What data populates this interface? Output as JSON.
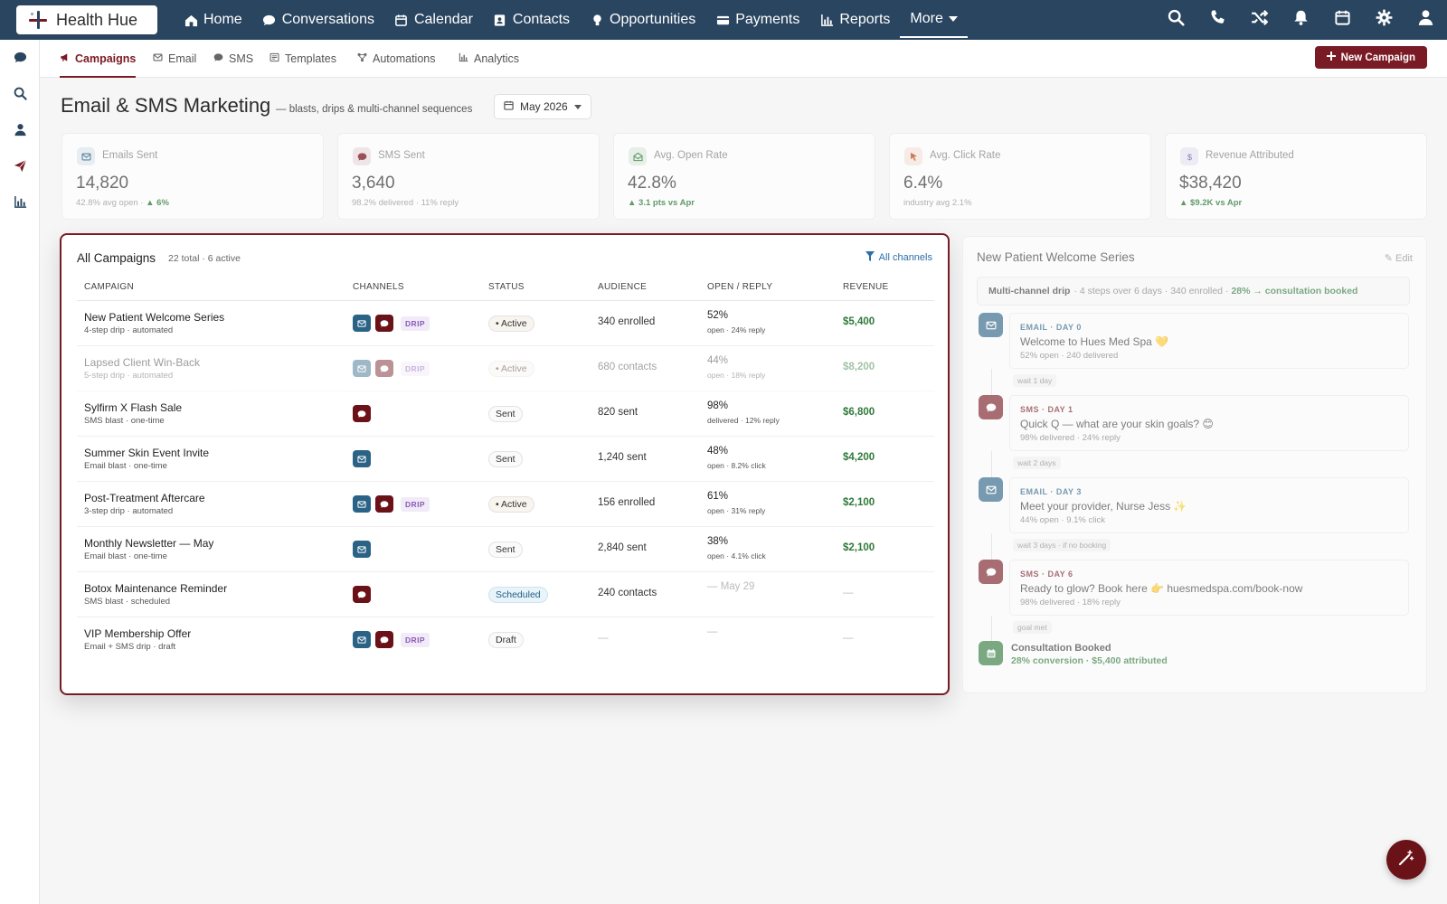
{
  "brand": {
    "name": "Health Hue"
  },
  "nav": {
    "items": [
      {
        "label": "Home",
        "icon": "home-icon"
      },
      {
        "label": "Conversations",
        "icon": "chat-icon"
      },
      {
        "label": "Calendar",
        "icon": "calendar-icon"
      },
      {
        "label": "Contacts",
        "icon": "contact-card-icon"
      },
      {
        "label": "Opportunities",
        "icon": "lightbulb-icon"
      },
      {
        "label": "Payments",
        "icon": "card-icon"
      },
      {
        "label": "Reports",
        "icon": "bar-chart-icon"
      }
    ],
    "more_label": "More",
    "right_icons": [
      "search-icon",
      "phone-icon",
      "shuffle-icon",
      "bell-icon",
      "calendar-icon",
      "gear-icon",
      "user-icon"
    ]
  },
  "rail": {
    "icons": [
      "chat-icon",
      "search-icon",
      "user-icon",
      "send-icon",
      "bar-chart-icon"
    ]
  },
  "subtabs": [
    {
      "label": "Campaigns",
      "icon": "megaphone-icon",
      "active": true
    },
    {
      "label": "Email",
      "icon": "envelope-icon"
    },
    {
      "label": "SMS",
      "icon": "chat-icon"
    },
    {
      "label": "Templates",
      "icon": "template-icon"
    },
    {
      "label": "Automations",
      "icon": "flow-icon"
    },
    {
      "label": "Analytics",
      "icon": "bar-chart-icon"
    }
  ],
  "new_campaign_label": "New Campaign",
  "header": {
    "title": "Email & SMS Marketing",
    "subtitle": "— blasts, drips & multi-channel sequences",
    "month": "May 2026"
  },
  "stats": [
    {
      "label": "Emails Sent",
      "value": "14,820",
      "note": "42.8% avg open ·",
      "delta": "▲ 6%",
      "icon": "envelope-icon",
      "color": "#2b6386"
    },
    {
      "label": "SMS Sent",
      "value": "3,640",
      "note": "98.2% delivered · 11% reply",
      "delta": "",
      "icon": "chat-icon",
      "color": "#7a1a24"
    },
    {
      "label": "Avg. Open Rate",
      "value": "42.8%",
      "note": "",
      "delta": "▲ 3.1 pts vs Apr",
      "icon": "envelope-open-icon",
      "color": "#2f7a3a"
    },
    {
      "label": "Avg. Click Rate",
      "value": "6.4%",
      "note": "industry avg 2.1%",
      "delta": "",
      "icon": "pointer-icon",
      "color": "#c2521d"
    },
    {
      "label": "Revenue Attributed",
      "value": "$38,420",
      "note": "",
      "delta": "▲ $9.2K vs Apr",
      "icon": "dollar-icon",
      "color": "#6b4fa8"
    }
  ],
  "campaigns": {
    "title": "All Campaigns",
    "count": "22 total · 6 active",
    "filter_label": "All channels",
    "columns": [
      "CAMPAIGN",
      "CHANNELS",
      "STATUS",
      "AUDIENCE",
      "OPEN / REPLY",
      "REVENUE"
    ],
    "rows": [
      {
        "name": "New Patient Welcome Series",
        "meta": "4-step drip · automated",
        "channels": [
          "email",
          "sms"
        ],
        "drip": "DRIP",
        "status": "• Active",
        "status_type": "active",
        "audience": "340 enrolled",
        "rate": "52%",
        "rate_sub": "open · 24% reply",
        "revenue": "$5,400",
        "faded": false
      },
      {
        "name": "Lapsed Client Win-Back",
        "meta": "5-step drip · automated",
        "channels": [
          "email",
          "sms"
        ],
        "drip": "DRIP",
        "status": "• Active",
        "status_type": "active",
        "audience": "680 contacts",
        "rate": "44%",
        "rate_sub": "open · 18% reply",
        "revenue": "$8,200",
        "faded": true
      },
      {
        "name": "Sylfirm X Flash Sale",
        "meta": "SMS blast · one-time",
        "channels": [
          "sms"
        ],
        "drip": "",
        "status": "Sent",
        "status_type": "sent",
        "audience": "820 sent",
        "rate": "98%",
        "rate_sub": "delivered · 12% reply",
        "revenue": "$6,800",
        "faded": false
      },
      {
        "name": "Summer Skin Event Invite",
        "meta": "Email blast · one-time",
        "channels": [
          "email"
        ],
        "drip": "",
        "status": "Sent",
        "status_type": "sent",
        "audience": "1,240 sent",
        "rate": "48%",
        "rate_sub": "open · 8.2% click",
        "revenue": "$4,200",
        "faded": false
      },
      {
        "name": "Post-Treatment Aftercare",
        "meta": "3-step drip · automated",
        "channels": [
          "email",
          "sms"
        ],
        "drip": "DRIP",
        "status": "• Active",
        "status_type": "active",
        "audience": "156 enrolled",
        "rate": "61%",
        "rate_sub": "open · 31% reply",
        "revenue": "$2,100",
        "faded": false
      },
      {
        "name": "Monthly Newsletter — May",
        "meta": "Email blast · one-time",
        "channels": [
          "email"
        ],
        "drip": "",
        "status": "Sent",
        "status_type": "sent",
        "audience": "2,840 sent",
        "rate": "38%",
        "rate_sub": "open · 4.1% click",
        "revenue": "$2,100",
        "faded": false
      },
      {
        "name": "Botox Maintenance Reminder",
        "meta": "SMS blast · scheduled",
        "channels": [
          "sms"
        ],
        "drip": "",
        "status": "Scheduled",
        "status_type": "scheduled",
        "audience": "240 contacts",
        "rate": "— May 29",
        "rate_sub": "",
        "revenue": "—",
        "faded": false
      },
      {
        "name": "VIP Membership Offer",
        "meta": "Email + SMS drip · draft",
        "channels": [
          "email",
          "sms"
        ],
        "drip": "DRIP",
        "status": "Draft",
        "status_type": "draft",
        "audience": "—",
        "rate": "—",
        "rate_sub": "",
        "revenue": "—",
        "faded": false
      }
    ]
  },
  "sequence": {
    "title": "New Patient Welcome Series",
    "edit_label": "Edit",
    "summary_bold": "Multi-channel drip",
    "summary_text": "· 4 steps over 6 days · 340 enrolled ·",
    "summary_green": "28% → consultation booked",
    "steps": [
      {
        "kind": "EMAIL · DAY 0",
        "type": "email",
        "title": "Welcome to Hues Med Spa 💛",
        "stats": "52% open · 240 delivered",
        "wait_after": "wait 1 day"
      },
      {
        "kind": "SMS · DAY 1",
        "type": "sms",
        "title": "Quick Q — what are your skin goals? 😊",
        "stats": "98% delivered · 24% reply",
        "wait_after": "wait 2 days"
      },
      {
        "kind": "EMAIL · DAY 3",
        "type": "email",
        "title": "Meet your provider, Nurse Jess ✨",
        "stats": "44% open · 9.1% click",
        "wait_after": "wait 3 days · if no booking"
      },
      {
        "kind": "SMS · DAY 6",
        "type": "sms",
        "title": "Ready to glow? Book here 👉 huesmedspa.com/book-now",
        "stats": "98% delivered · 18% reply",
        "wait_after": "goal met"
      }
    ],
    "goal": {
      "title": "Consultation Booked",
      "sub": "28% conversion · $5,400 attributed"
    }
  },
  "colors": {
    "brand": "#7a1a24",
    "nav": "#2a4560",
    "email": "#2b6386",
    "sms": "#6b1218",
    "positive": "#2f7a3a"
  }
}
